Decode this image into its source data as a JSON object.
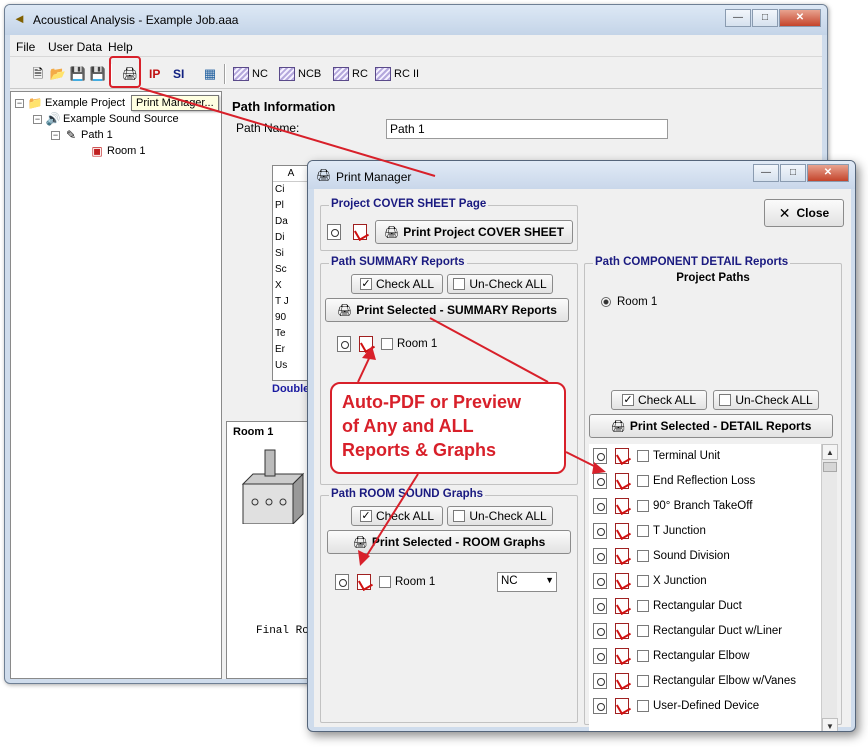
{
  "main_window": {
    "title": "Acoustical Analysis - Example Job.aaa",
    "menu": [
      "File",
      "User Data",
      "Help"
    ],
    "toolbar": {
      "ip_label": "IP",
      "si_label": "SI",
      "graph_buttons": [
        "NC",
        "NCB",
        "RC",
        "RC II"
      ]
    },
    "tooltip": "Print Manager...",
    "tree": {
      "project": "Example Project",
      "source": "Example Sound Source",
      "path": "Path 1",
      "room": "Room 1"
    },
    "path_info": {
      "heading": "Path Information",
      "name_label": "Path Name:",
      "name_value": "Path 1"
    },
    "component_list_header": "A",
    "component_items": [
      "Ci",
      "Pl",
      "Da",
      "Di",
      "Si",
      "Sc",
      "X",
      "T J",
      "90",
      "Te",
      "Er",
      "Us"
    ],
    "double_click_label": "Double",
    "room_panel_title": "Room 1",
    "final_label": "Final Ro"
  },
  "dialog": {
    "title": "Print Manager",
    "close_label": "Close",
    "cover_sheet": {
      "group_title": "Project COVER SHEET Page",
      "print_button": "Print Project COVER SHEET"
    },
    "summary": {
      "group_title": "Path SUMMARY Reports",
      "check_all": "Check ALL",
      "uncheck_all": "Un-Check ALL",
      "print_button": "Print Selected - SUMMARY Reports",
      "items": [
        "Room 1"
      ]
    },
    "room_sound": {
      "group_title": "Path ROOM SOUND Graphs",
      "check_all": "Check ALL",
      "uncheck_all": "Un-Check ALL",
      "print_button": "Print Selected - ROOM Graphs",
      "items": [
        "Room 1"
      ],
      "curve_select": "NC"
    },
    "detail": {
      "group_title": "Path COMPONENT DETAIL Reports",
      "project_paths_label": "Project Paths",
      "path_radio": "Room 1",
      "check_all": "Check ALL",
      "uncheck_all": "Un-Check ALL",
      "print_button": "Print Selected - DETAIL Reports",
      "items": [
        "Terminal Unit",
        "End Reflection Loss",
        "90° Branch TakeOff",
        "T Junction",
        "Sound Division",
        "X Junction",
        "Rectangular Duct",
        "Rectangular Duct w/Liner",
        "Rectangular Elbow",
        "Rectangular Elbow w/Vanes",
        "User-Defined Device"
      ]
    }
  },
  "callout": {
    "line1": "Auto-PDF or Preview",
    "line2": "of Any and ALL",
    "line3": "Reports & Graphs"
  },
  "colors": {
    "accent_red": "#d8202a",
    "group_title_blue": "#1a1a80"
  }
}
